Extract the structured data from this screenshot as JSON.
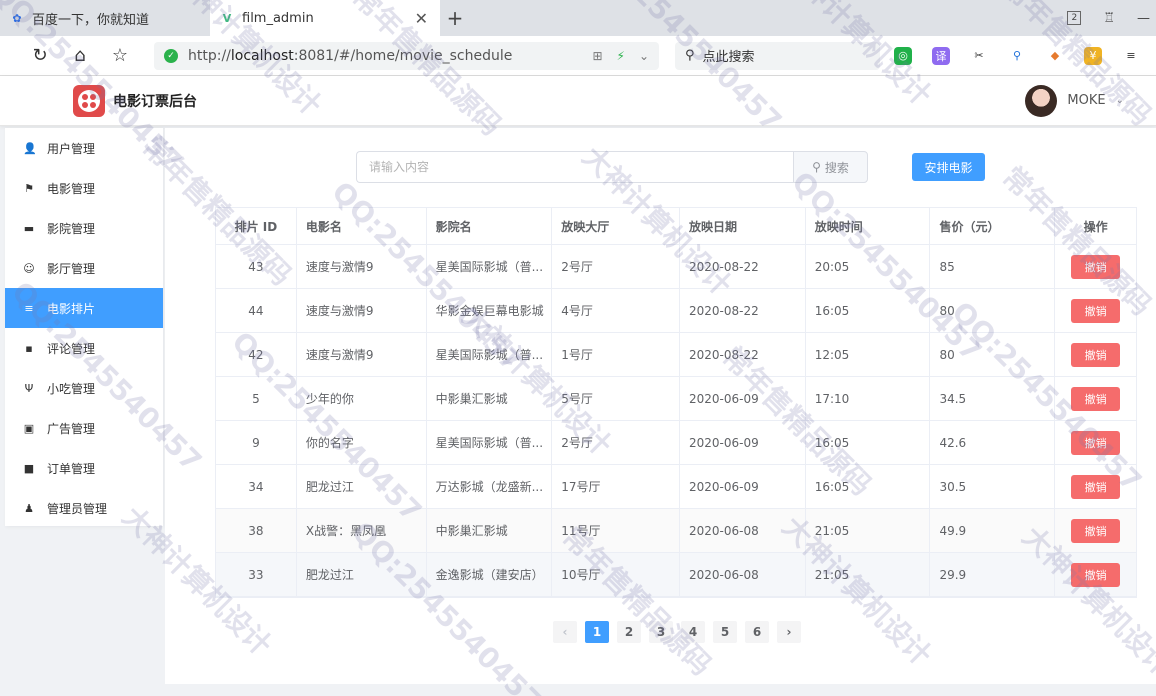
{
  "browser": {
    "tabs": [
      {
        "label": "百度一下，你就知道",
        "active": false
      },
      {
        "label": "film_admin",
        "active": true
      }
    ],
    "tab_count_badge": "2",
    "url_prefix": "http://",
    "url_host": "localhost",
    "url_rest": ":8081/#/home/movie_schedule",
    "search_placeholder": "点此搜索"
  },
  "app": {
    "title": "电影订票后台",
    "user_name": "MOKE"
  },
  "sidebar": {
    "items": [
      {
        "label": "用户管理",
        "icon": "user-icon",
        "glyph": "👤",
        "active": false
      },
      {
        "label": "电影管理",
        "icon": "flag-icon",
        "glyph": "⚑",
        "active": false
      },
      {
        "label": "影院管理",
        "icon": "truck-icon",
        "glyph": "▬",
        "active": false
      },
      {
        "label": "影厅管理",
        "icon": "smile-icon",
        "glyph": "☺",
        "active": false
      },
      {
        "label": "电影排片",
        "icon": "list-icon",
        "glyph": "≡",
        "active": true
      },
      {
        "label": "评论管理",
        "icon": "comment-icon",
        "glyph": "▪",
        "active": false
      },
      {
        "label": "小吃管理",
        "icon": "food-icon",
        "glyph": "Ψ",
        "active": false
      },
      {
        "label": "广告管理",
        "icon": "picture-icon",
        "glyph": "▣",
        "active": false
      },
      {
        "label": "订单管理",
        "icon": "ticket-icon",
        "glyph": "■",
        "active": false
      },
      {
        "label": "管理员管理",
        "icon": "admin-icon",
        "glyph": "♟",
        "active": false
      }
    ]
  },
  "toolbar": {
    "search_placeholder": "请输入内容",
    "search_button": "搜索",
    "schedule_button": "安排电影"
  },
  "table": {
    "headers": [
      "排片 ID",
      "电影名",
      "影院名",
      "放映大厅",
      "放映日期",
      "放映时间",
      "售价（元）",
      "操作"
    ],
    "action_label": "撤销",
    "rows": [
      [
        "43",
        "速度与激情9",
        "星美国际影城（普...",
        "2号厅",
        "2020-08-22",
        "20:05",
        "85"
      ],
      [
        "44",
        "速度与激情9",
        "华影金娱巨幕电影城",
        "4号厅",
        "2020-08-22",
        "16:05",
        "80"
      ],
      [
        "42",
        "速度与激情9",
        "星美国际影城（普...",
        "1号厅",
        "2020-08-22",
        "12:05",
        "80"
      ],
      [
        "5",
        "少年的你",
        "中影巢汇影城",
        "5号厅",
        "2020-06-09",
        "17:10",
        "34.5"
      ],
      [
        "9",
        "你的名字",
        "星美国际影城（普...",
        "2号厅",
        "2020-06-09",
        "16:05",
        "42.6"
      ],
      [
        "34",
        "肥龙过江",
        "万达影城（龙盛新...",
        "17号厅",
        "2020-06-09",
        "16:05",
        "30.5"
      ],
      [
        "38",
        "X战警：黑凤凰",
        "中影巢汇影城",
        "11号厅",
        "2020-06-08",
        "21:05",
        "49.9"
      ],
      [
        "33",
        "肥龙过江",
        "金逸影城（建安店）",
        "10号厅",
        "2020-06-08",
        "21:05",
        "29.9"
      ]
    ]
  },
  "pagination": {
    "prev": "‹",
    "pages": [
      "1",
      "2",
      "3",
      "4",
      "5",
      "6"
    ],
    "current": "1",
    "next": "›"
  },
  "watermark": {
    "texts": [
      "大神计算机设计",
      "常年售精品源码",
      "QQ:2545540457"
    ]
  },
  "colors": {
    "primary": "#409eff",
    "danger": "#f56c6c",
    "logo": "#e04a4a"
  }
}
